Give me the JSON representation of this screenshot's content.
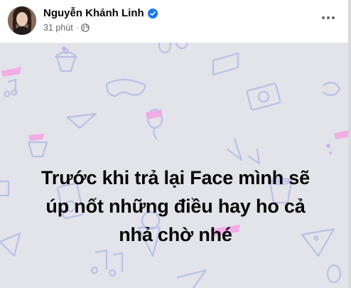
{
  "post": {
    "author": "Nguyễn Khánh Linh",
    "time": "31 phút",
    "separator": "·",
    "privacy_icon": "globe-icon",
    "verified_icon": "verified-badge-icon",
    "more_icon": "more-options-icon",
    "text_lines": [
      "Trước khi trả lại Face mình sẽ",
      "úp nốt những điều hay ho cả",
      "nhả chờ nhé"
    ],
    "background_color": "#e3e3ea",
    "accent_colors": [
      "#b7c3e8",
      "#f3a6e6",
      "#c9a5f5"
    ]
  }
}
